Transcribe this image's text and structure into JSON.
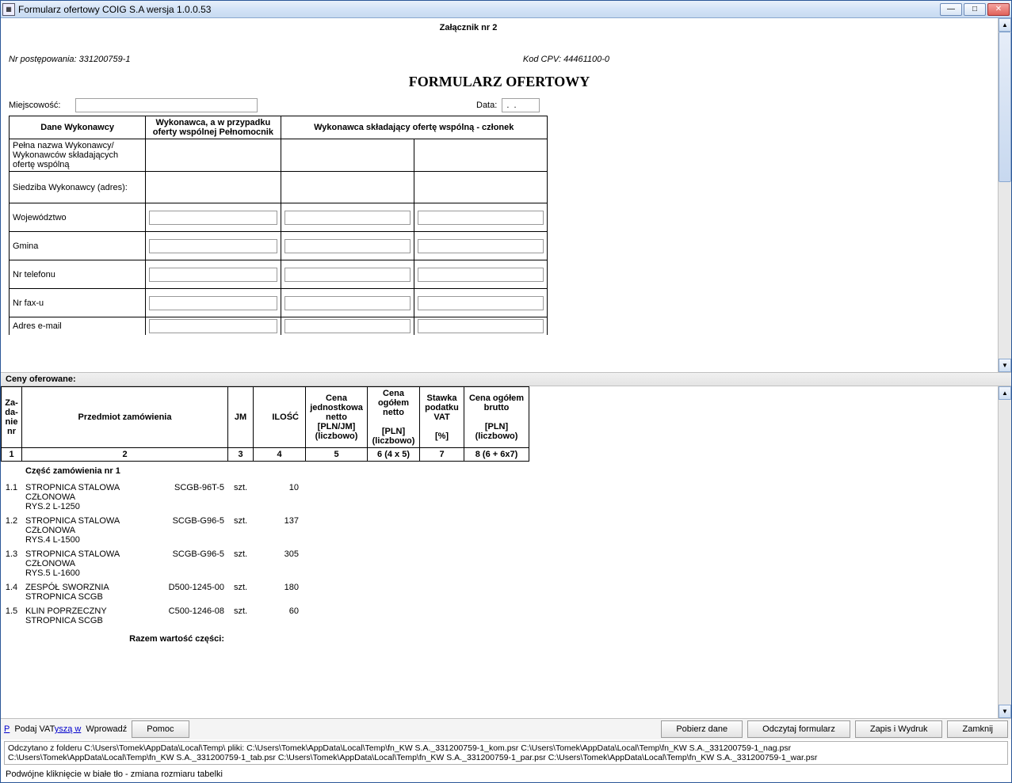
{
  "window": {
    "title": "Formularz ofertowy COIG S.A wersja 1.0.0.53"
  },
  "header": {
    "attachment": "Załącznik nr 2",
    "proceeding_label": "Nr postępowania:",
    "proceeding_no": "331200759-1",
    "cpv_label": "Kod CPV:",
    "cpv": "44461100-0",
    "form_title": "FORMULARZ OFERTOWY",
    "locality_label": "Miejscowość:",
    "locality_value": "",
    "date_label": "Data:",
    "date_value": " .  ."
  },
  "contractor": {
    "col_data": "Dane Wykonawcy",
    "col_proxy": "Wykonawca, a w przypadku oferty wspólnej Pełnomocnik",
    "col_member": "Wykonawca składający ofertę wspólną - członek",
    "rows": {
      "full_name": "Pełna nazwa Wykonawcy/ Wykonawców składających ofertę wspólną",
      "address": "Siedziba Wykonawcy (adres):",
      "province": "Województwo",
      "commune": "Gmina",
      "phone": "Nr telefonu",
      "fax": "Nr fax-u",
      "email": "Adres e-mail"
    }
  },
  "prices": {
    "section_label": "Ceny oferowane:",
    "cols": {
      "nr": "Za-\nda-\nnie\nnr",
      "subject": "Przedmiot zamówienia",
      "jm": "JM",
      "qty": "ILOŚĆ",
      "unit_price": "Cena jednostkowa netto\n[PLN/JM]\n(liczbowo)",
      "net_total": "Cena ogółem netto\n\n[PLN]\n(liczbowo)",
      "vat": "Stawka podatku VAT\n\n[%]",
      "gross": "Cena ogółem brutto\n\n[PLN]\n(liczbowo)"
    },
    "nums": {
      "nr": "1",
      "subject": "2",
      "jm": "3",
      "qty": "4",
      "unit_price": "5",
      "net_total": "6 (4 x 5)",
      "vat": "7",
      "gross": "8 (6 + 6x7)"
    },
    "part_label": "Część zamówienia nr 1",
    "items": [
      {
        "nr": "1.1",
        "name": "STROPNICA STALOWA CZŁONOWA",
        "code": "SCGB-96T-5",
        "line2": "RYS.2 L-1250",
        "jm": "szt.",
        "qty": "10"
      },
      {
        "nr": "1.2",
        "name": "STROPNICA STALOWA CZŁONOWA",
        "code": "SCGB-G96-5",
        "line2": "RYS.4 L-1500",
        "jm": "szt.",
        "qty": "137"
      },
      {
        "nr": "1.3",
        "name": "STROPNICA STALOWA CZŁONOWA",
        "code": "SCGB-G96-5",
        "line2": "RYS.5 L-1600",
        "jm": "szt.",
        "qty": "305"
      },
      {
        "nr": "1.4",
        "name": "ZESPÓŁ SWORZNIA",
        "code": "D500-1245-00",
        "line2": "STROPNICA SCGB",
        "jm": "szt.",
        "qty": "180"
      },
      {
        "nr": "1.5",
        "name": "KLIN POPRZECZNY",
        "code": "C500-1246-08",
        "line2": "STROPNICA SCGB",
        "jm": "szt.",
        "qty": "60"
      }
    ],
    "total_label": "Razem wartość części:"
  },
  "toolbar": {
    "p_link": "P",
    "vat_text": "Podaj  VAT",
    "all_link": "yszą w",
    "wprowadz": "Wprowadź",
    "pomoc": "Pomoc",
    "pobierz": "Pobierz dane",
    "odczytaj": "Odczytaj formularz",
    "zapis": "Zapis i Wydruk",
    "zamknij": "Zamknij"
  },
  "log": {
    "line1": "Odczytano z folderu C:\\Users\\Tomek\\AppData\\Local\\Temp\\ pliki: C:\\Users\\Tomek\\AppData\\Local\\Temp\\fn_KW S.A._331200759-1_kom.psr  C:\\Users\\Tomek\\AppData\\Local\\Temp\\fn_KW S.A._331200759-1_nag.psr",
    "line2": "C:\\Users\\Tomek\\AppData\\Local\\Temp\\fn_KW S.A._331200759-1_tab.psr  C:\\Users\\Tomek\\AppData\\Local\\Temp\\fn_KW S.A._331200759-1_par.psr  C:\\Users\\Tomek\\AppData\\Local\\Temp\\fn_KW S.A._331200759-1_war.psr"
  },
  "hint": "Podwójne kliknięcie w białe tło - zmiana rozmiaru tabelki"
}
